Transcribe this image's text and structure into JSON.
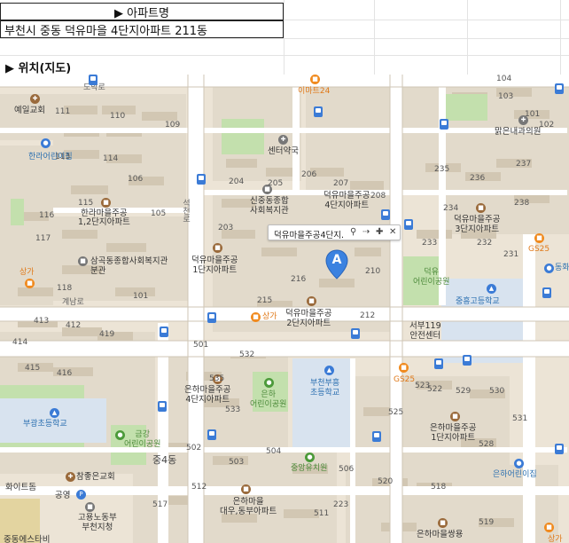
{
  "sheet": {
    "title_cell": "▶ 아파트명",
    "address_cell": "부천시 중동 덕유마을 4단지아파트 211동",
    "section_label": "▶ 위치(지도)"
  },
  "map": {
    "popup": {
      "label": "덕유마을주공4단지.",
      "tools": [
        "marker-icon",
        "route-icon",
        "zoom-in-icon",
        "close-icon"
      ]
    },
    "marker_letter": "A",
    "labels": {
      "domak_ro": "도막로",
      "yeil_church": "예일교회",
      "hanra_daycare": "한라어린이집",
      "hanra_apt": "한라마을주공\n1,2단지아파트",
      "samgok_welfare": "삼곡동종합사회복지관\n분관",
      "sangga1": "상가",
      "gyenam_ro": "계남로",
      "pharmacy": "센터약국",
      "sinjung_welfare": "신중동종합\n사회복지관",
      "deogyu4": "덕유마을주공\n4단지아파트",
      "deogyu1": "덕유마을주공\n1단지아파트",
      "deogyu2": "덕유마을주공\n2단지아파트",
      "deogyu3": "덕유마을주공\n3단지아파트",
      "deogyu_park": "덕유\n어린이공원",
      "seokcheon_ro": "석천로",
      "sangga2": "상가",
      "joonggong_school": "중흥고등학교",
      "seobu119": "서부119\n안전센터",
      "apt24": "이마트24",
      "malgeun_clinic": "맑은내과의원",
      "gs25_a": "GS25",
      "gs25_b": "GS25",
      "dong_hwa": "동화",
      "eunha4": "은하마을주공\n4단지아파트",
      "eunha_park": "은하\n어린이공원",
      "bucheon_elem": "부천부흥\n초등학교",
      "eunha1": "은하마을주공\n1단지아파트",
      "eunha_daycare": "은하어린이집",
      "bugwang_elem": "부광초등학교",
      "geumgang_park": "금강\n어린이공원",
      "jung4dong": "중4동",
      "jungang_kinder": "중앙유치원",
      "chamjoeun_church": "참좋은교회",
      "whitedom": "화이트돔",
      "gongyoung": "공영",
      "eunha_daewoo": "은하마을\n대우,동부아파트",
      "goyong": "고용노동부\n부천지청",
      "eunha_ssangyong": "은하마을쌍용",
      "jungdong_pr": "중동에스타비",
      "sangga3": "상가"
    },
    "building_numbers": [
      "104",
      "103",
      "101",
      "102",
      "111",
      "110",
      "109",
      "113",
      "114",
      "106",
      "115",
      "105",
      "116",
      "117",
      "118",
      "119",
      "101",
      "413",
      "412",
      "414",
      "415",
      "416",
      "419",
      "204",
      "205",
      "206",
      "207",
      "208",
      "202",
      "203",
      "215",
      "216",
      "210",
      "212",
      "231",
      "232",
      "233",
      "234",
      "235",
      "236",
      "237",
      "238",
      "221",
      "222",
      "223",
      "520",
      "521",
      "522",
      "523",
      "524",
      "525",
      "526",
      "527",
      "528",
      "529",
      "530",
      "531",
      "532",
      "533",
      "534",
      "535",
      "501",
      "502",
      "503",
      "504",
      "505",
      "506",
      "511",
      "512",
      "517",
      "518",
      "519",
      "520"
    ]
  },
  "colors": {
    "map_bg": "#ece4d6",
    "block": "#e3dccf",
    "road": "#ffffff",
    "green": "#bfe0a8",
    "school": "#e3d6a3",
    "marker": "#3b82e0"
  }
}
